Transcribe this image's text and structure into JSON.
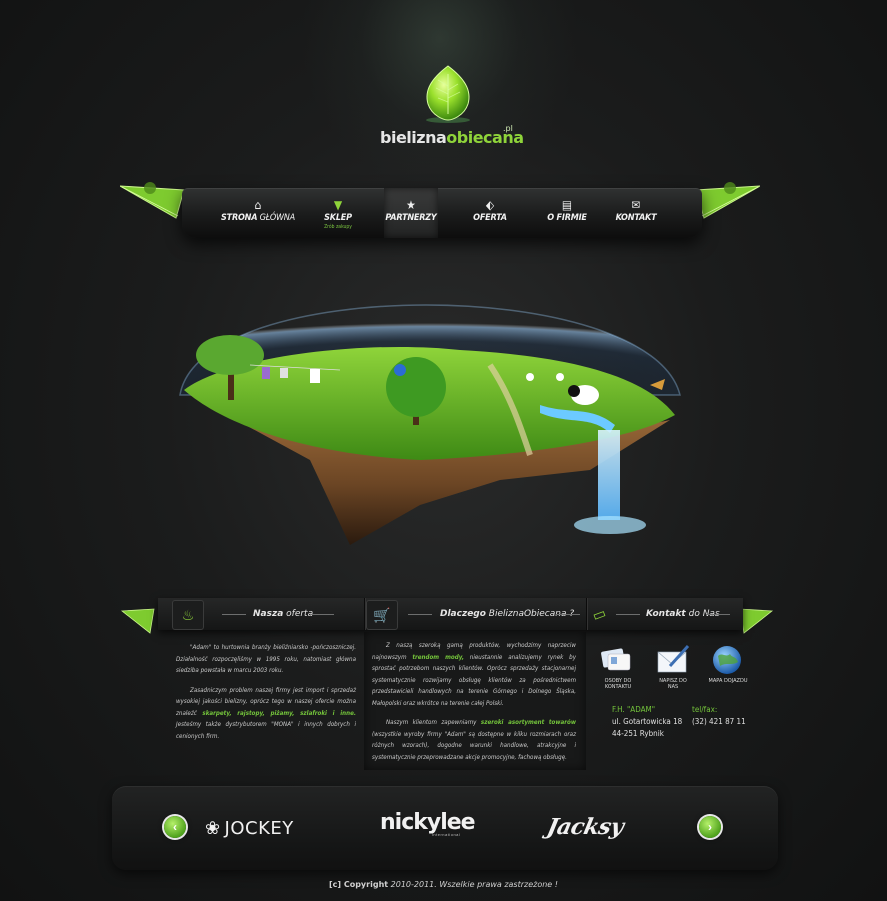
{
  "header": {
    "logo_text_a": "bielizna",
    "logo_text_b": "obiecana",
    "logo_tld": ".pl",
    "colors": {
      "accent": "#8fd43a",
      "background": "#1b1c1c"
    }
  },
  "nav": {
    "items": [
      {
        "icon": "home-icon",
        "label_bold": "STRONA",
        "label_thin": " GŁÓWNA",
        "sub": ""
      },
      {
        "icon": "shirt-icon",
        "label_bold": "SKLEP",
        "label_thin": "",
        "sub": "Zrób zakupy"
      },
      {
        "icon": "star-icon",
        "label_bold": "PARTNERZY",
        "label_thin": "",
        "sub": ""
      },
      {
        "icon": "tag-icon",
        "label_bold": "OFERTA",
        "label_thin": "",
        "sub": ""
      },
      {
        "icon": "document-icon",
        "label_bold": "O FIRMIE",
        "label_thin": "",
        "sub": ""
      },
      {
        "icon": "envelope-icon",
        "label_bold": "KONTAKT",
        "label_thin": "",
        "sub": ""
      }
    ],
    "active_index": 2
  },
  "info": {
    "col1_title_bold": "Nasza",
    "col1_title_rest": " oferta",
    "col2_title_bold": "Dlaczego",
    "col2_title_rest": " BieliznaObiecana ?",
    "col3_title_bold": "Kontakt",
    "col3_title_rest": " do Nas"
  },
  "col1": {
    "p1": "\"Adam\" to hurtownia branży bieliźniarsko -pończoszniczej. Działalność rozpoczęliśmy w 1995 roku, natomiast główna siedziba powstała w marcu 2003 roku.",
    "p2_a": "Zasadniczym problem naszej firmy jest import i sprzedaż wysokiej jakości bielizny, oprócz tego w naszej ofercie można znaleźć ",
    "p2_hl": "skarpety, rajstopy, piżamy, szlafroki i inne.",
    "p2_b": " Jesteśmy także dystrybutorem \"MONA\" i innych dobrych i cenionych firm."
  },
  "col2": {
    "p1_a": "Z naszą szeroką gamą produktów, wychodzimy naprzeciw najnowszym ",
    "p1_hl": "trendom mody,",
    "p1_b": " nieustannie analizujemy rynek by sprostać potrzebom naszych klientów. Oprócz sprzedaży stacjonarnej systematycznie rozwijamy obsługę klientów za pośrednictwem przedstawicieli handlowych na terenie Górnego i Dolnego Śląska, Małopolski oraz wkrótce na terenie całej Polski.",
    "p2_a": "Naszym klientom zapewniamy ",
    "p2_hl": "szeroki asortyment towarów",
    "p2_b": " (wszystkie wyroby firmy \"Adam\" są dostępne w kilku rozmiarach oraz różnych wzorach), dogodne warunki handlowe, atrakcyjne i systematycznie przeprowadzane akcje promocyjne, fachową obsługę."
  },
  "contact": {
    "icons": [
      {
        "icon": "contact-cards-icon",
        "label_1": "OSOBY DO",
        "label_2": "KONTAKTU"
      },
      {
        "icon": "write-letter-icon",
        "label_1": "NAPISZ DO",
        "label_2": "NAS"
      },
      {
        "icon": "globe-icon",
        "label_1": "MAPA DOJAZDU",
        "label_2": ""
      }
    ],
    "company": "F.H. \"ADAM\"",
    "street": "ul. Gotartowicka 18",
    "city": "44-251 Rybnik",
    "phone_label": "tel/fax:",
    "phone": "(32) 421 87 11"
  },
  "partners": {
    "items": [
      "JOCKEY",
      "nickylee",
      "international",
      "Jacksy"
    ]
  },
  "footer": {
    "bold": "[c] Copyright",
    "rest": " 2010-2011. Wszelkie prawa zastrzeżone !"
  }
}
